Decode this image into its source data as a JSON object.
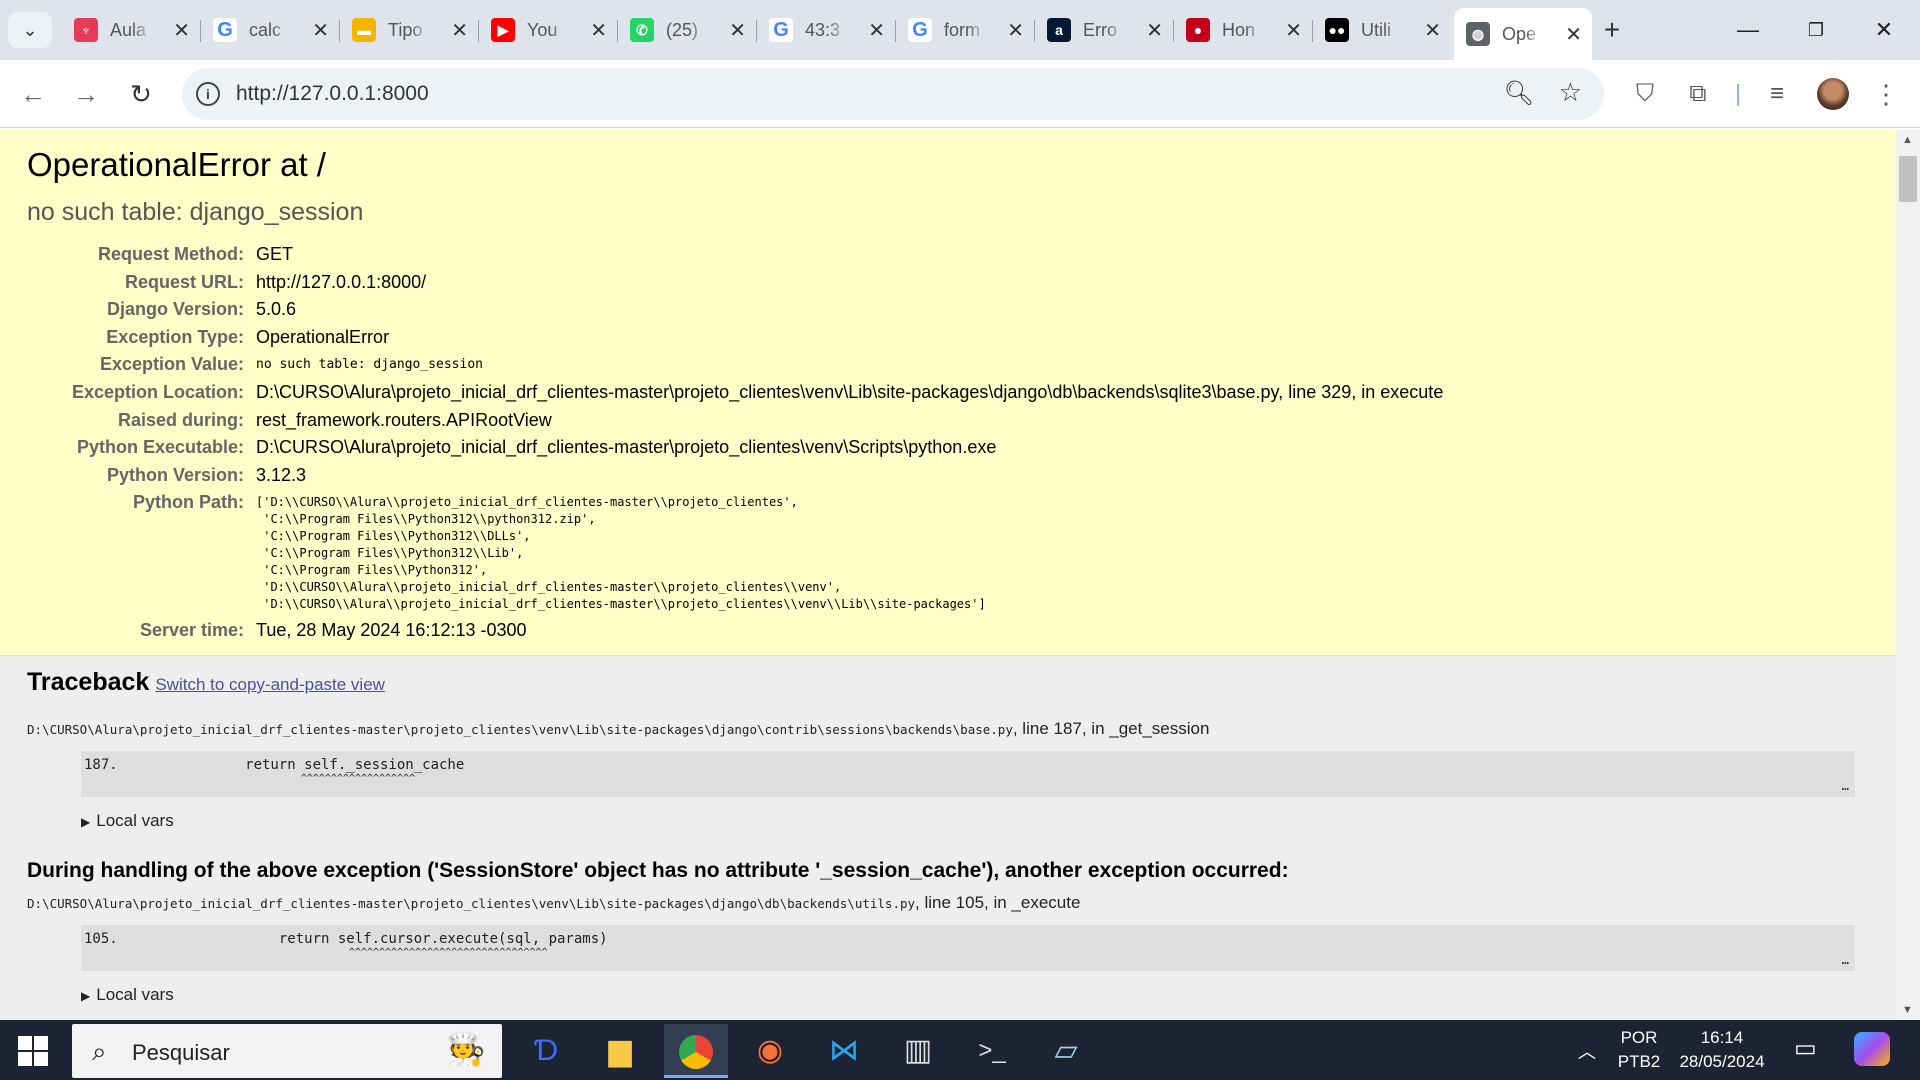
{
  "browser": {
    "tabs": [
      {
        "title": "Aula",
        "favicon": "alura-icon",
        "color": "#e33b58"
      },
      {
        "title": "calc",
        "favicon": "google-icon",
        "color": "#4285f4"
      },
      {
        "title": "Tipo",
        "favicon": "slides-icon",
        "color": "#f4b400"
      },
      {
        "title": "You",
        "favicon": "youtube-icon",
        "color": "#ff0000"
      },
      {
        "title": "(25)",
        "favicon": "whatsapp-icon",
        "color": "#25d366",
        "badge": "25"
      },
      {
        "title": "43:3",
        "favicon": "google-icon",
        "color": "#4285f4"
      },
      {
        "title": "form",
        "favicon": "google-icon",
        "color": "#4285f4"
      },
      {
        "title": "Erro",
        "favicon": "alura-a-icon",
        "color": "#051933"
      },
      {
        "title": "Hon",
        "favicon": "hinge-icon",
        "color": "#c2001a"
      },
      {
        "title": "Utili",
        "favicon": "medium-icon",
        "color": "#000000"
      },
      {
        "title": "Ope",
        "favicon": "globe-icon",
        "color": "#5f6368",
        "active": true
      }
    ],
    "url": "http://127.0.0.1:8000"
  },
  "page": {
    "title": "OperationalError at /",
    "subtitle": "no such table: django_session",
    "meta": [
      {
        "label": "Request Method:",
        "value": "GET"
      },
      {
        "label": "Request URL:",
        "value": "http://127.0.0.1:8000/"
      },
      {
        "label": "Django Version:",
        "value": "5.0.6"
      },
      {
        "label": "Exception Type:",
        "value": "OperationalError"
      },
      {
        "label": "Exception Value:",
        "value": "no such table: django_session"
      },
      {
        "label": "Exception Location:",
        "value": "D:\\CURSO\\Alura\\projeto_inicial_drf_clientes-master\\projeto_clientes\\venv\\Lib\\site-packages\\django\\db\\backends\\sqlite3\\base.py, line 329, in execute"
      },
      {
        "label": "Raised during:",
        "value": "rest_framework.routers.APIRootView"
      },
      {
        "label": "Python Executable:",
        "value": "D:\\CURSO\\Alura\\projeto_inicial_drf_clientes-master\\projeto_clientes\\venv\\Scripts\\python.exe"
      },
      {
        "label": "Python Version:",
        "value": "3.12.3"
      },
      {
        "label": "Python Path:",
        "value": "['D:\\\\CURSO\\\\Alura\\\\projeto_inicial_drf_clientes-master\\\\projeto_clientes',\n 'C:\\\\Program Files\\\\Python312\\\\python312.zip',\n 'C:\\\\Program Files\\\\Python312\\\\DLLs',\n 'C:\\\\Program Files\\\\Python312\\\\Lib',\n 'C:\\\\Program Files\\\\Python312',\n 'D:\\\\CURSO\\\\Alura\\\\projeto_inicial_drf_clientes-master\\\\projeto_clientes\\\\venv',\n 'D:\\\\CURSO\\\\Alura\\\\projeto_inicial_drf_clientes-master\\\\projeto_clientes\\\\venv\\\\Lib\\\\site-packages']"
      },
      {
        "label": "Server time:",
        "value": "Tue, 28 May 2024 16:12:13 -0300"
      }
    ],
    "traceback": {
      "heading": "Traceback",
      "switch_link": "Switch to copy-and-paste view",
      "frames": [
        {
          "file": "D:\\CURSO\\Alura\\projeto_inicial_drf_clientes-master\\projeto_clientes\\venv\\Lib\\site-packages\\django\\contrib\\sessions\\backends\\base.py",
          "where": ", line 187, in _get_session",
          "line_no": "187.",
          "code": "            return self._session_cache",
          "caret": "                                    ^^^^^^^^^^^^^^^^^^^",
          "more": "…",
          "local_vars": "Local vars"
        },
        {
          "file": "D:\\CURSO\\Alura\\projeto_inicial_drf_clientes-master\\projeto_clientes\\venv\\Lib\\site-packages\\django\\db\\backends\\utils.py",
          "where": ", line 105, in _execute",
          "line_no": "105.",
          "code": "                return self.cursor.execute(sql, params)",
          "caret": "                                            ^^^^^^^^^^^^^^^^^^^^^^^^^^^^^^^^^",
          "more": "…",
          "local_vars": "Local vars"
        }
      ],
      "during": "During handling of the above exception ('SessionStore' object has no attribute '_session_cache'), another exception occurred:"
    }
  },
  "taskbar": {
    "search_placeholder": "Pesquisar",
    "language": "POR",
    "layout": "PTB2",
    "time": "16:14",
    "date": "28/05/2024"
  }
}
